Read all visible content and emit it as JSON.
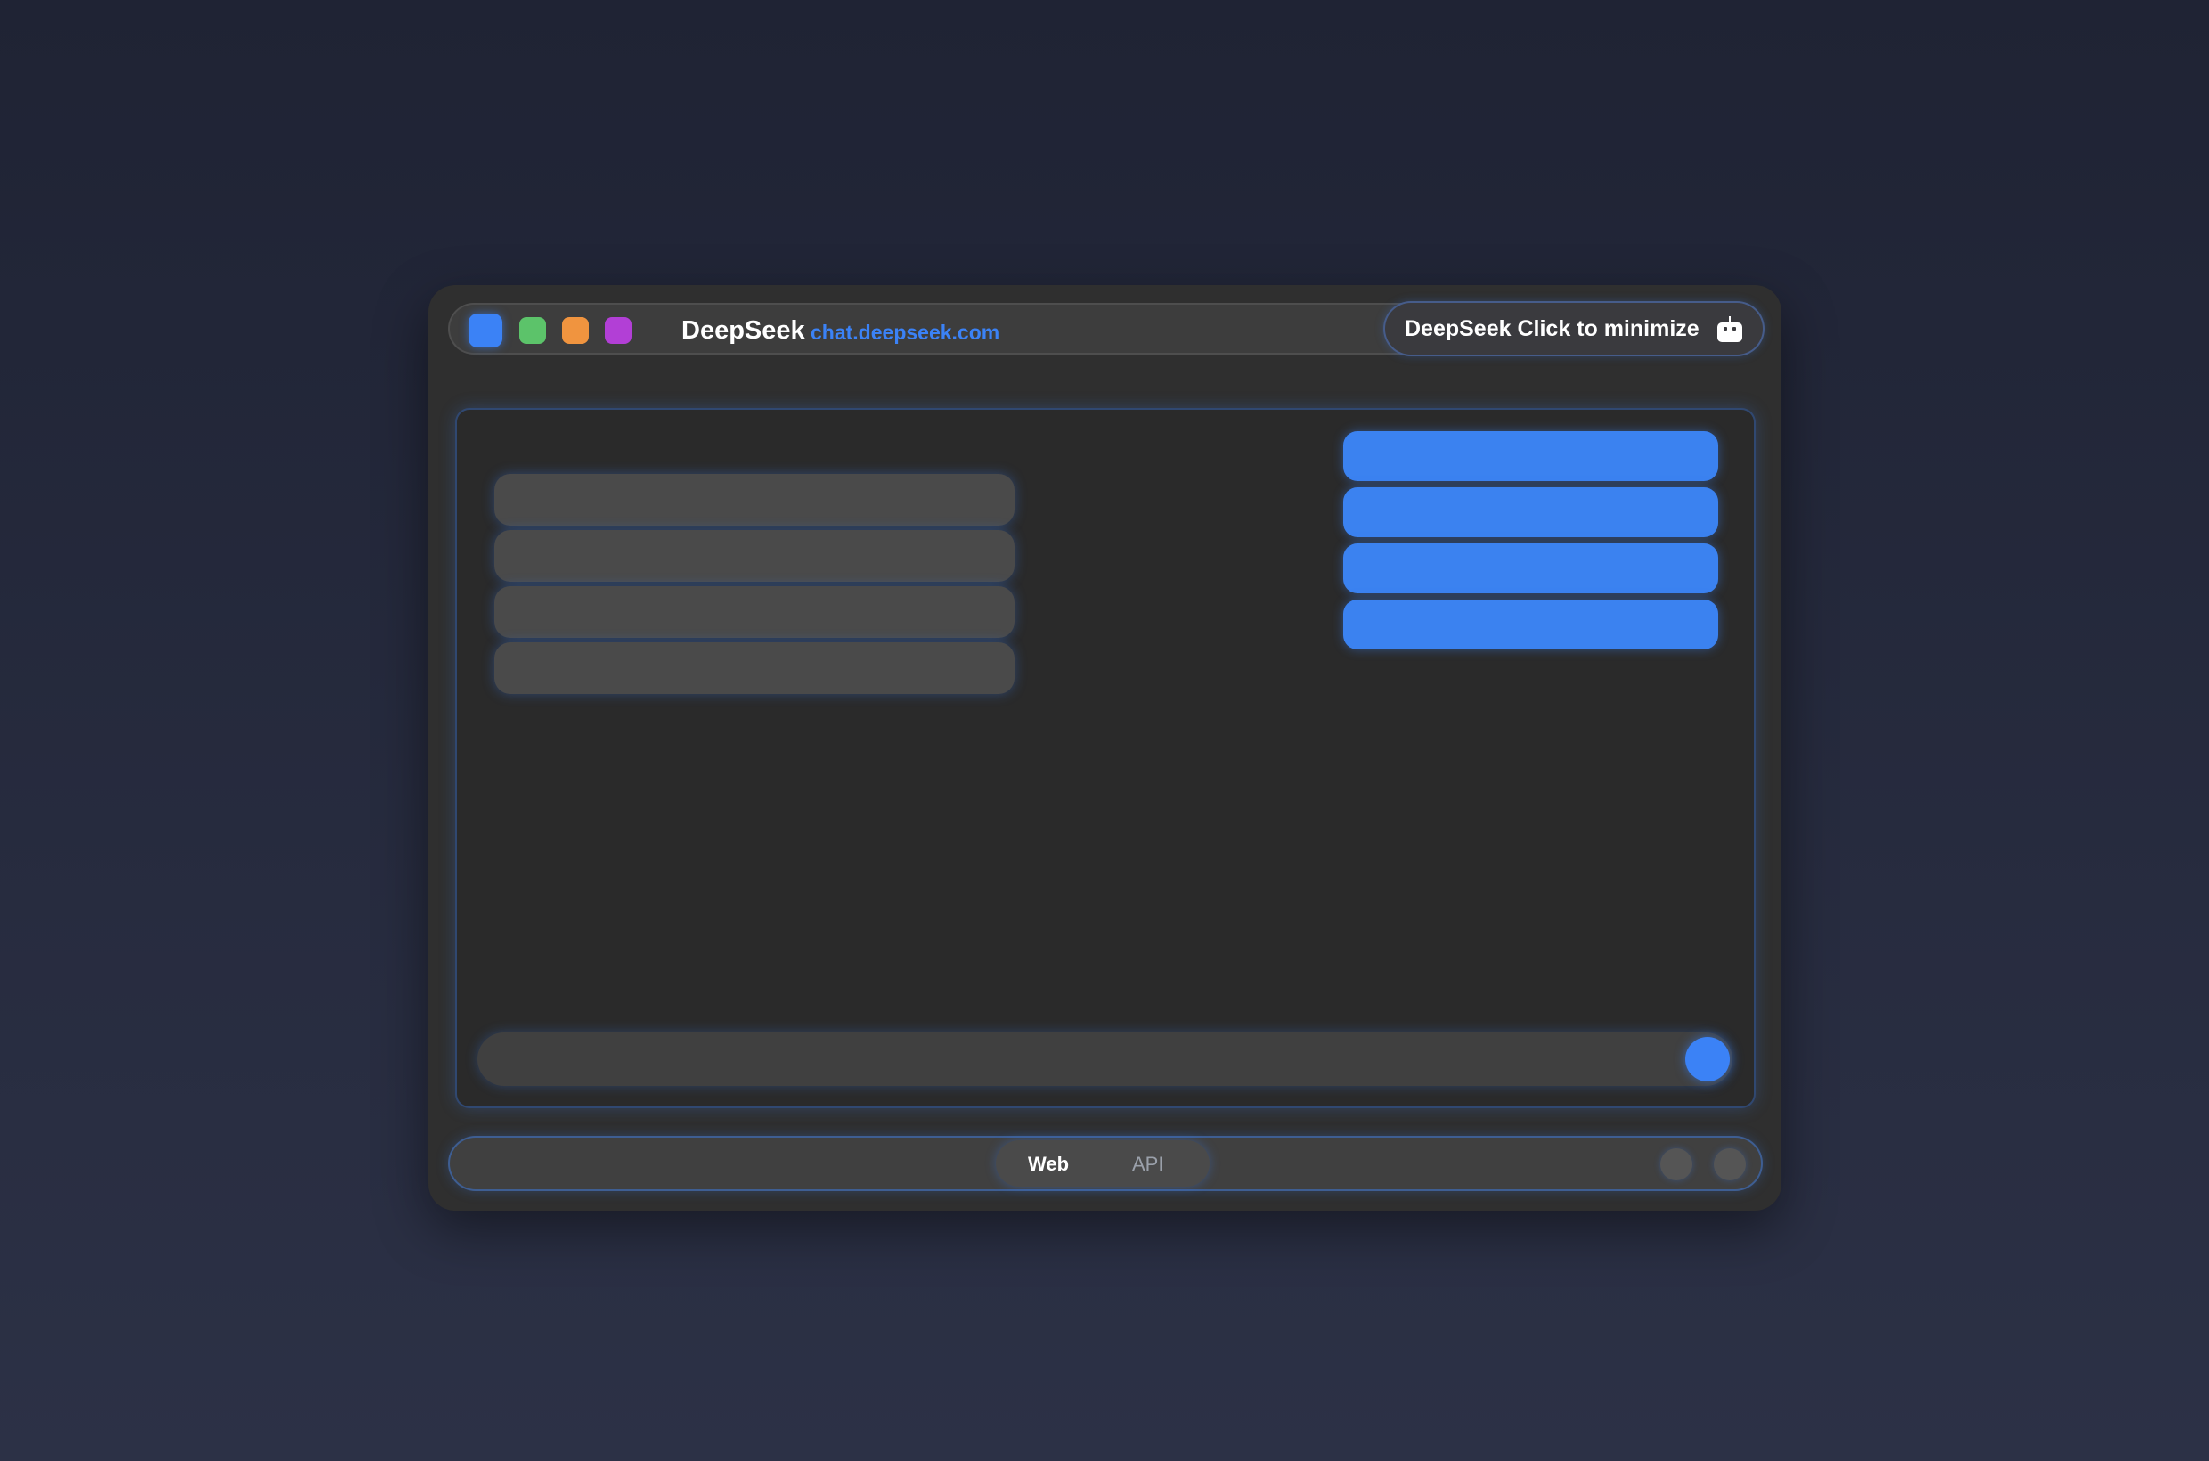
{
  "titlebar": {
    "app_name": "DeepSeek",
    "url": "chat.deepseek.com",
    "window_dots": [
      {
        "name": "blue",
        "color": "#3b82f6"
      },
      {
        "name": "green",
        "color": "#5cc36a"
      },
      {
        "name": "orange",
        "color": "#f0943f"
      },
      {
        "name": "purple",
        "color": "#b23fd6"
      }
    ],
    "minimize_label": "DeepSeek Click to minimize",
    "minimize_icon": "robot-icon"
  },
  "chat": {
    "received_messages": [
      "",
      "",
      "",
      ""
    ],
    "sent_messages": [
      "",
      "",
      "",
      ""
    ],
    "input_value": "",
    "send_icon": "send-icon"
  },
  "footer": {
    "modes": [
      {
        "label": "Web",
        "active": true
      },
      {
        "label": "API",
        "active": false
      }
    ],
    "circle_buttons": [
      "settings-button",
      "more-button"
    ]
  },
  "colors": {
    "accent": "#3b82f6",
    "window_bg": "#2f2f2f",
    "panel_bg": "#2a2a2a",
    "bubble_received": "#4a4a4a"
  }
}
